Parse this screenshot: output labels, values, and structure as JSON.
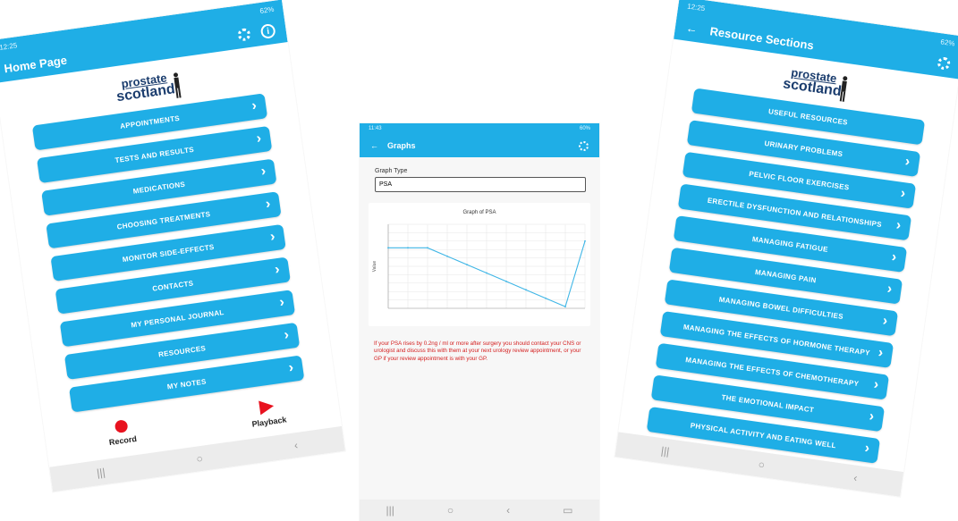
{
  "home": {
    "status_time": "12:25",
    "status_right": "62%",
    "title": "Home Page",
    "logo_line1": "prostate",
    "logo_line2": "scotland",
    "menu": [
      "APPOINTMENTS",
      "TESTS AND RESULTS",
      "MEDICATIONS",
      "CHOOSING TREATMENTS",
      "MONITOR SIDE-EFFECTS",
      "CONTACTS",
      "MY PERSONAL JOURNAL",
      "RESOURCES",
      "MY NOTES"
    ],
    "record_label": "Record",
    "playback_label": "Playback",
    "icons": {
      "settings": "gear-icon",
      "info": "info-icon"
    }
  },
  "graphs": {
    "status_time": "11:43",
    "status_right": "60%",
    "title": "Graphs",
    "graph_type_label": "Graph Type",
    "graph_type_value": "PSA",
    "chart_title": "Graph of PSA",
    "y_label": "Value",
    "warning": "If your PSA rises by 0.2ng / ml or more after surgery you should contact your CNS or urologist and discuss this with them at your next urology review appointment, or your GP if your review appointment is with your GP."
  },
  "resources": {
    "status_time": "12:25",
    "status_right": "62%",
    "title": "Resource Sections",
    "logo_line1": "prostate",
    "logo_line2": "scotland",
    "menu": [
      "USEFUL RESOURCES",
      "URINARY PROBLEMS",
      "PELVIC FLOOR EXERCISES",
      "ERECTILE DYSFUNCTION AND RELATIONSHIPS",
      "MANAGING FATIGUE",
      "MANAGING PAIN",
      "MANAGING BOWEL DIFFICULTIES",
      "MANAGING THE EFFECTS OF HORMONE THERAPY",
      "MANAGING THE EFFECTS OF CHEMOTHERAPY",
      "THE EMOTIONAL IMPACT",
      "PHYSICAL ACTIVITY AND EATING WELL"
    ]
  },
  "chart_data": {
    "type": "line",
    "title": "Graph of PSA",
    "ylabel": "Value",
    "series": [
      {
        "values": [
          0.72,
          0.72,
          0.72,
          0.62,
          0.52,
          0.42,
          0.32,
          0.22,
          0.12,
          0.02,
          0.8
        ]
      }
    ],
    "ylim": [
      0,
      1
    ],
    "grid": true
  },
  "colors": {
    "accent": "#1faee6",
    "warning": "#d42020",
    "record": "#e8121f",
    "logo": "#1b3d6e"
  }
}
